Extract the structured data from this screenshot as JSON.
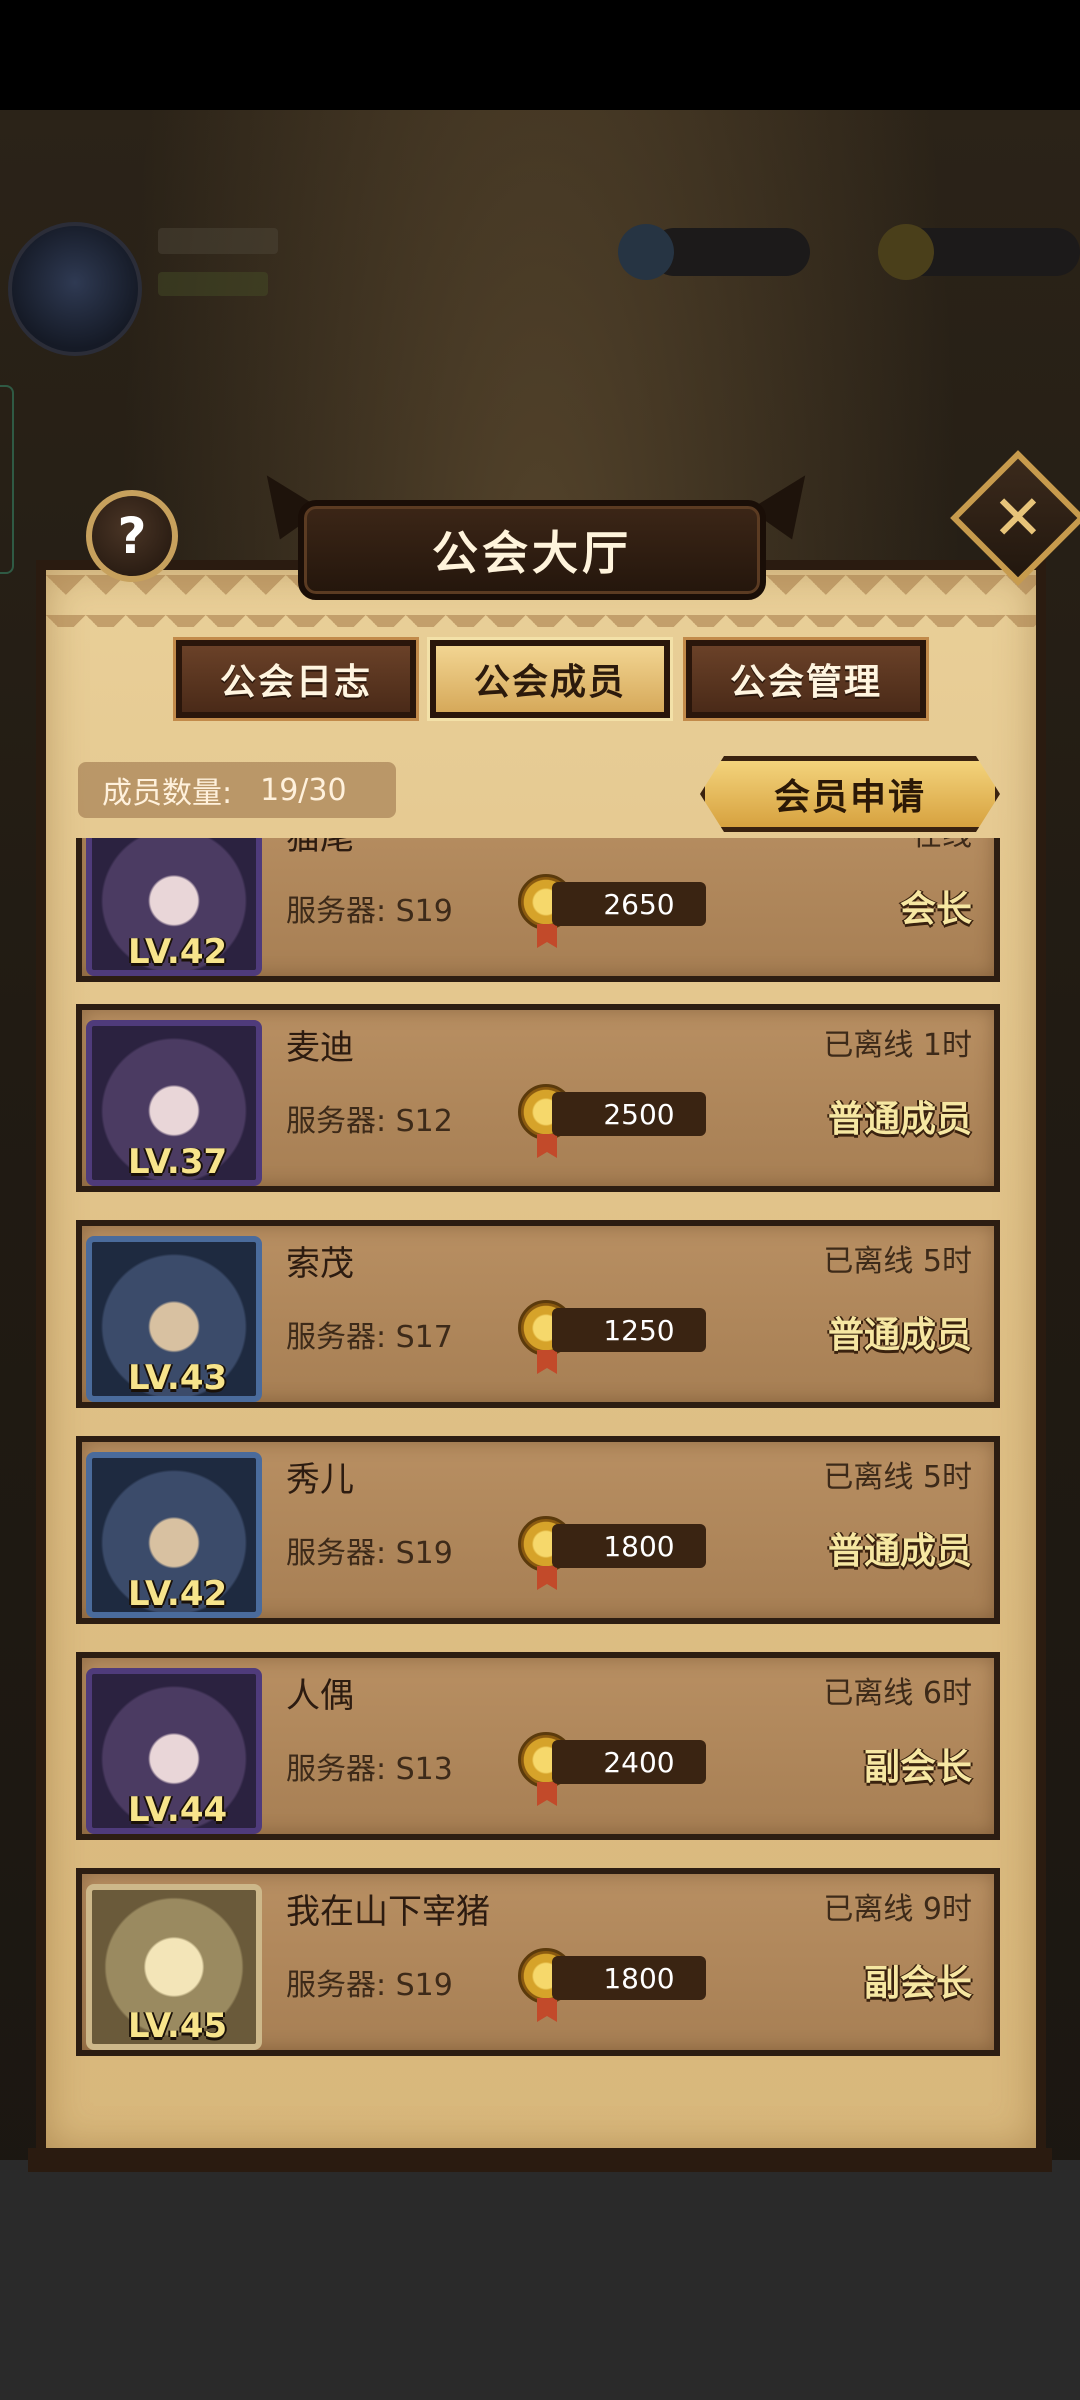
{
  "panel": {
    "title": "公会大厅",
    "help_label": "?",
    "close_label": "✕"
  },
  "tabs": [
    {
      "label": "公会日志",
      "active": false
    },
    {
      "label": "公会成员",
      "active": true
    },
    {
      "label": "公会管理",
      "active": false
    }
  ],
  "member_count": {
    "label": "成员数量:",
    "value": "19/30"
  },
  "apply_button_label": "会员申请",
  "members": [
    {
      "name": "猫尾",
      "level": "LV.42",
      "server": "服务器: S19",
      "contribution": "2650",
      "status": "在线",
      "role": "会长",
      "frame": "purple"
    },
    {
      "name": "麦迪",
      "level": "LV.37",
      "server": "服务器: S12",
      "contribution": "2500",
      "status": "已离线 1时",
      "role": "普通成员",
      "frame": "purple"
    },
    {
      "name": "索茂",
      "level": "LV.43",
      "server": "服务器: S17",
      "contribution": "1250",
      "status": "已离线 5时",
      "role": "普通成员",
      "frame": "blue"
    },
    {
      "name": "秀儿",
      "level": "LV.42",
      "server": "服务器: S19",
      "contribution": "1800",
      "status": "已离线 5时",
      "role": "普通成员",
      "frame": "blue"
    },
    {
      "name": "人偶",
      "level": "LV.44",
      "server": "服务器: S13",
      "contribution": "2400",
      "status": "已离线 6时",
      "role": "副会长",
      "frame": "purple"
    },
    {
      "name": "我在山下宰猪",
      "level": "LV.45",
      "server": "服务器: S19",
      "contribution": "1800",
      "status": "已离线 9时",
      "role": "副会长",
      "frame": "gold"
    }
  ]
}
